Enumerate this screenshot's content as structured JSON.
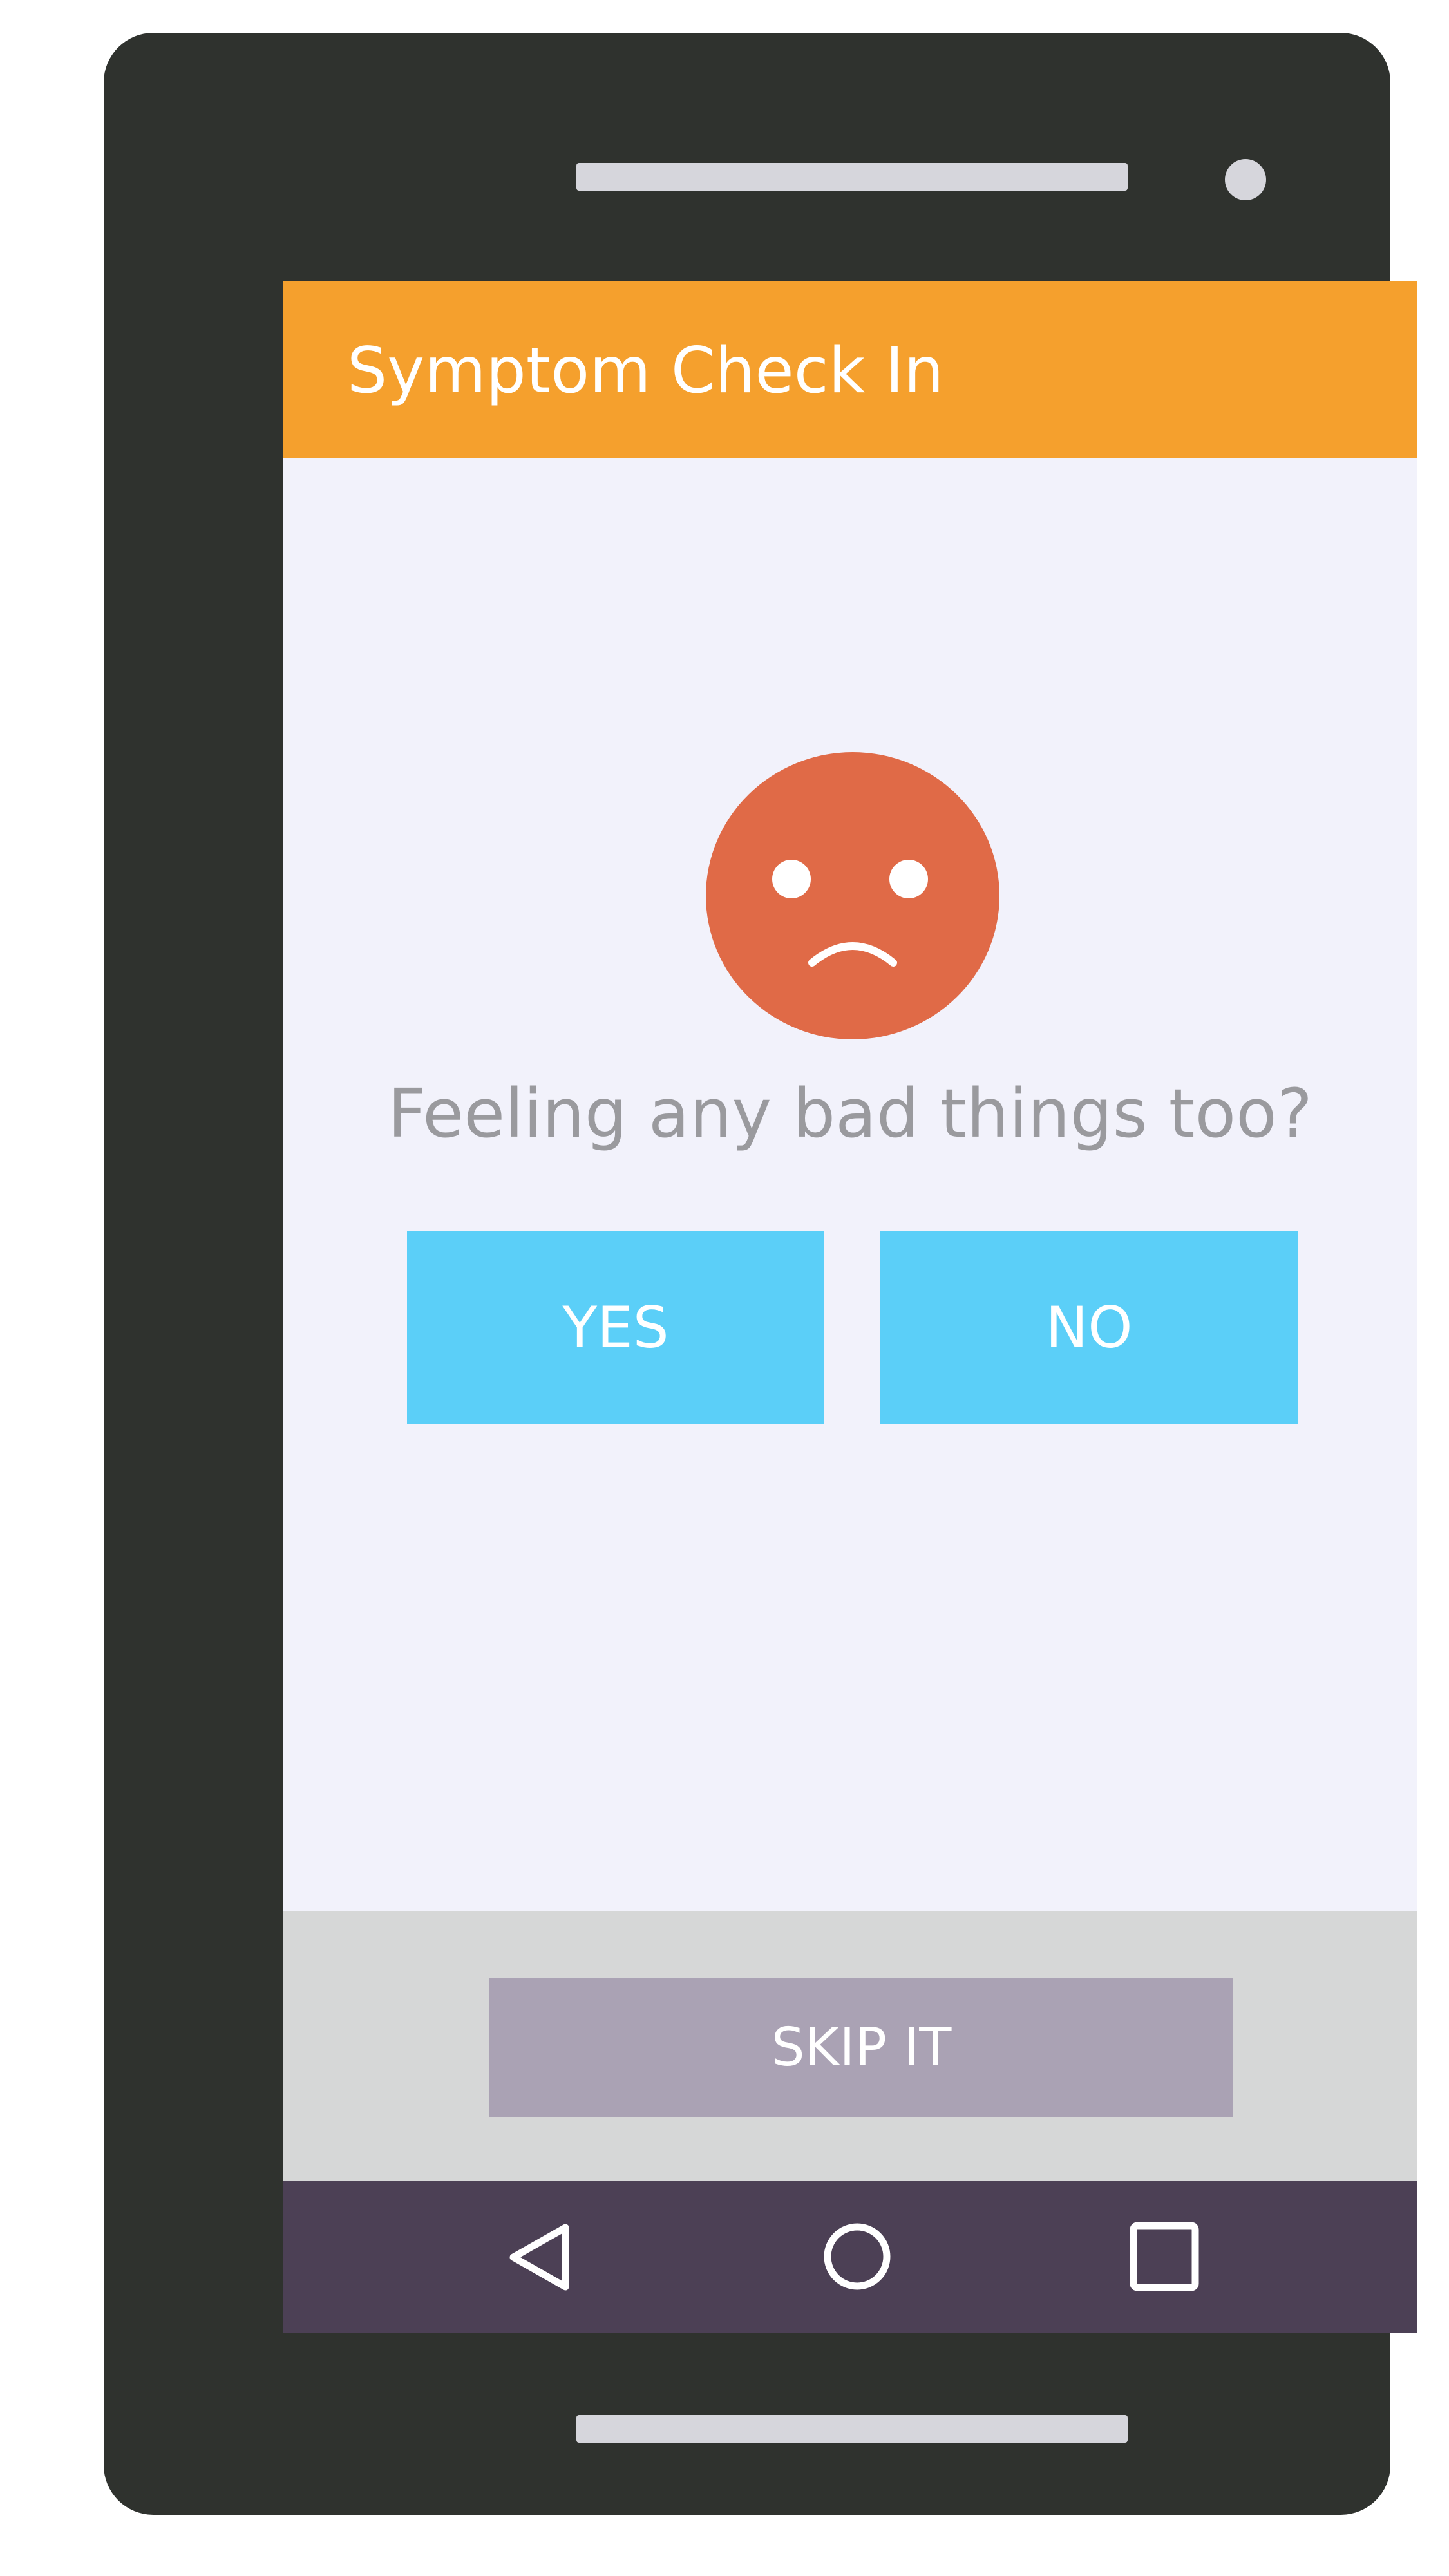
{
  "app": {
    "title": "Symptom Check In"
  },
  "main": {
    "face_icon": "sad-face-icon",
    "question": "Feeling any bad things too?",
    "yes_label": "YES",
    "no_label": "NO"
  },
  "footer": {
    "skip_label": "SKIP IT"
  },
  "nav": {
    "back_icon": "back-triangle-icon",
    "home_icon": "home-circle-icon",
    "recents_icon": "recents-square-icon"
  },
  "colors": {
    "device_body": "#2f322e",
    "app_bar": "#f5a02d",
    "screen_background": "#f2f2fb",
    "face": "#e06a47",
    "choice_buttons": "#5bcff8",
    "skip_area": "#d6d7d7",
    "skip_button": "#aaa2b4",
    "nav_bar": "#4c4055",
    "question_text": "#9a9a9e"
  }
}
